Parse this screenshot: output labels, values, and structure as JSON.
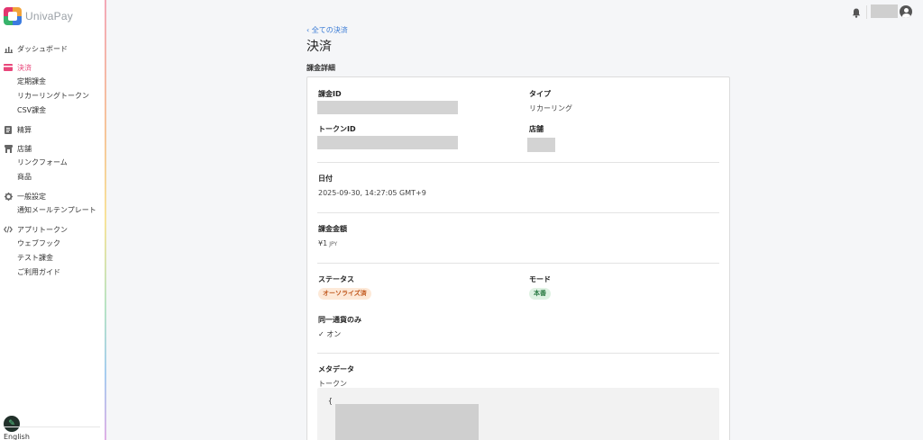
{
  "brand": {
    "name": "UnivaPay"
  },
  "sidebar": {
    "dashboard": "ダッシュボード",
    "payments": "決済",
    "payments_sub": [
      "定期課金",
      "リカーリングトークン",
      "CSV課金"
    ],
    "settlements": "精算",
    "stores": "店舗",
    "stores_sub": [
      "リンクフォーム",
      "商品"
    ],
    "general_settings": "一般設定",
    "general_settings_sub": [
      "通知メールテンプレート"
    ],
    "app_tokens": "アプリトークン",
    "app_tokens_sub": [
      "ウェブフック",
      "テスト課金",
      "ご利用ガイド"
    ],
    "language": "English"
  },
  "breadcrumb": "‹ 全ての決済",
  "page_title": "決済",
  "section_title": "課金詳細",
  "details": {
    "charge_id_label": "課金ID",
    "type_label": "タイプ",
    "type_value": "リカーリング",
    "token_id_label": "トークンID",
    "store_label": "店舗",
    "date_label": "日付",
    "date_value": "2025-09-30, 14:27:05 GMT+9",
    "amount_label": "課金金額",
    "amount_value": "¥1",
    "amount_unit": "JPY",
    "status_label": "ステータス",
    "status_value": "オーソライズ済",
    "mode_label": "モード",
    "mode_value": "本番",
    "same_currency_label": "同一通貨のみ",
    "same_currency_value": "オン",
    "metadata_label": "メタデータ",
    "metadata_sub": "トークン",
    "code_open": "{"
  },
  "colors": {
    "accent": "#e8467a",
    "link": "#3a7bd5"
  }
}
